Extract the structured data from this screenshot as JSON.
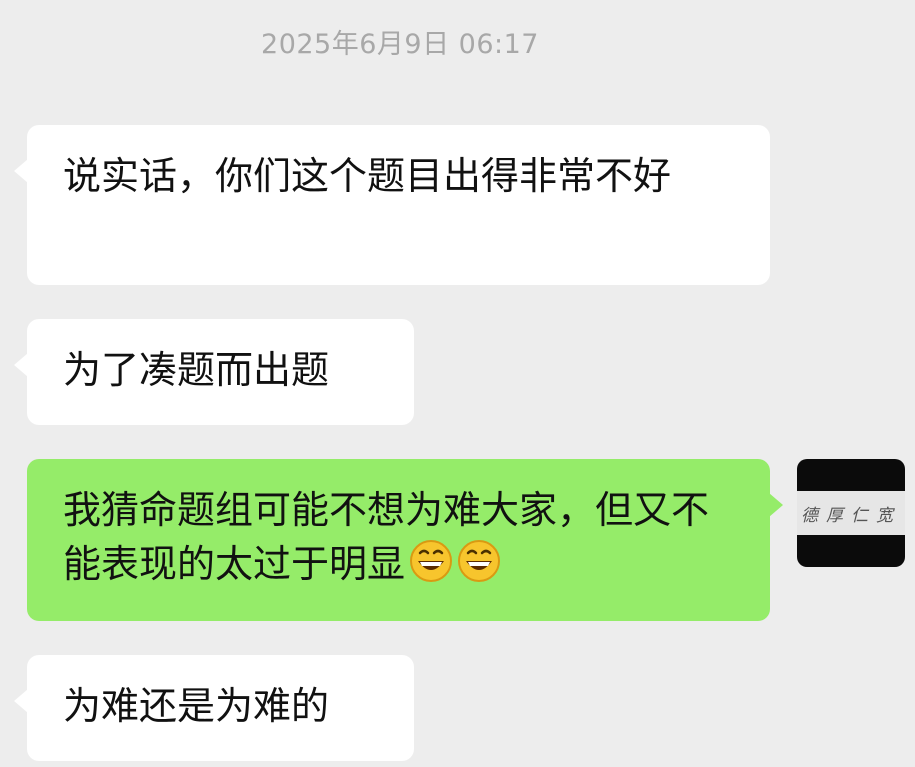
{
  "chat": {
    "timestamp": "2025年6月9日 06:17",
    "messages": [
      {
        "side": "left",
        "text": "说实话，你们这个题目出得非常不好"
      },
      {
        "side": "left",
        "text": "为了凑题而出题"
      },
      {
        "side": "right",
        "text": "我猜命题组可能不想为难大家，但又不能表现的太过于明显",
        "emoji": [
          "grinning-face-icon",
          "grinning-face-icon"
        ]
      },
      {
        "side": "left",
        "text": "为难还是为难的"
      }
    ]
  },
  "avatar": {
    "text": "德厚仁宽"
  },
  "colors": {
    "background": "#ededed",
    "incoming_bubble": "#ffffff",
    "outgoing_bubble": "#95ec69",
    "timestamp_text": "#a8a8a8"
  }
}
